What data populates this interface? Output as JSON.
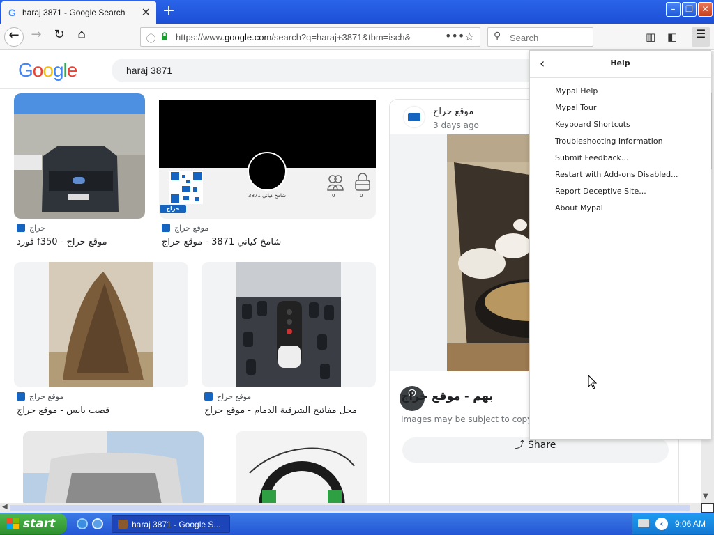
{
  "browser": {
    "tab_title": "haraj 3871 - Google Search",
    "tab_favicon": "G",
    "new_tab": "+",
    "url_prefix": "https://www.",
    "url_domain": "google.com",
    "url_rest": "/search?q=haraj+3871&tbm=isch&",
    "search_placeholder": "Search"
  },
  "google": {
    "query": "haraj 3871",
    "logo_letters": [
      {
        "ch": "G",
        "color": "#4285F4"
      },
      {
        "ch": "o",
        "color": "#EA4335"
      },
      {
        "ch": "o",
        "color": "#FBBC05"
      },
      {
        "ch": "g",
        "color": "#4285F4"
      },
      {
        "ch": "l",
        "color": "#34A853"
      },
      {
        "ch": "e",
        "color": "#EA4335"
      }
    ]
  },
  "results": [
    {
      "source": "حراج",
      "caption": "فورد f350 - موقع حراج"
    },
    {
      "source": "موقع حراج",
      "caption": "شامخ كياني 3871 - موقع حراج"
    },
    {
      "source": "موقع حراج",
      "caption": "قصب يابس - موقع حراج"
    },
    {
      "source": "موقع حراج",
      "caption": "محل مفاتيح الشرقية الدمام - موقع حراج"
    }
  ],
  "profile_card": {
    "name": "شامخ كياني 3871",
    "stat1": "0",
    "stat2": "0",
    "brand": "حراج"
  },
  "preview": {
    "site": "موقع حراج",
    "time": "3 days ago",
    "title": "بهم - موقع حراج",
    "notice": "Images may be subject to copyright.",
    "share": "Share"
  },
  "help_menu": {
    "title": "Help",
    "items": [
      "Mypal Help",
      "Mypal Tour",
      "Keyboard Shortcuts",
      "Troubleshooting Information",
      "Submit Feedback...",
      "Restart with Add-ons Disabled...",
      "Report Deceptive Site...",
      "About Mypal"
    ]
  },
  "taskbar": {
    "start": "start",
    "task_title": "haraj 3871 - Google S...",
    "clock": "9:06 AM"
  },
  "colors": {
    "title_bar": "#1c4fd6",
    "taskbar": "#2356d5",
    "start_green": "#3a9f3a",
    "haraj_blue": "#1565c0"
  }
}
